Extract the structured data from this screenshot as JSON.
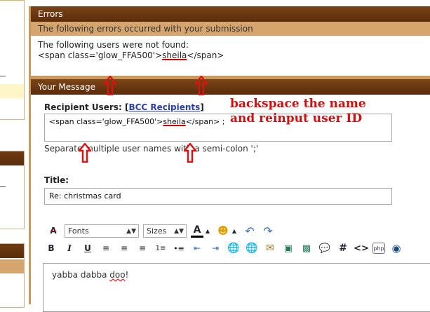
{
  "errors_panel": {
    "title": "Errors",
    "subtitle": "The following errors occurred with your submission",
    "line1": "The following users were not found:",
    "code_prefix": "<span class='glow_FFA500'>",
    "code_name": "sheila",
    "code_suffix": "</span>"
  },
  "message_panel": {
    "title": "Your Message",
    "recipient_label": "Recipient Users:",
    "bcc_link": "BCC Recipients",
    "recipient_value_prefix": "<span class='glow_FFA500'>",
    "recipient_value_name": "sheila",
    "recipient_value_suffix": "</span> ;",
    "separate_hint": "Separate multiple user names with a semi-colon ';'",
    "title_label": "Title:",
    "title_value": "Re: christmas card",
    "editor_text_1": "yabba dabba ",
    "editor_text_2": "doo",
    "editor_text_3": "!"
  },
  "annotation": {
    "line1": "backspace the name",
    "line2": "and reinput user ID"
  },
  "toolbar": {
    "fonts_label": "Fonts",
    "sizes_label": "Sizes"
  },
  "colors": {
    "header_brown": "#6b3812",
    "sub_tan": "#d5a56d",
    "frame_tan": "#c8985c",
    "annotation_red": "#d01010",
    "link_blue": "#2a3fa8"
  }
}
